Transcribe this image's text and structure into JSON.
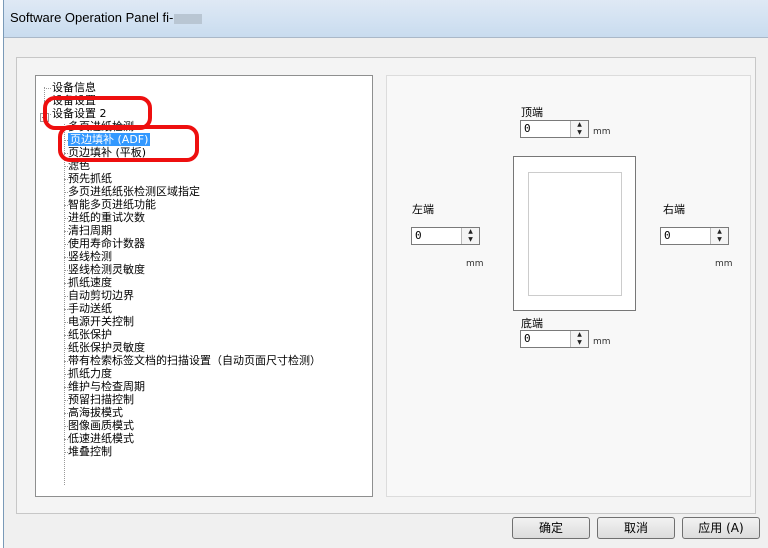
{
  "window": {
    "title": "Software Operation Panel fi-"
  },
  "tree": {
    "items": [
      {
        "label": "设备信息",
        "level": 0
      },
      {
        "label": "设备设置",
        "level": 0
      },
      {
        "label": "设备设置 2",
        "level": 0
      },
      {
        "label": "多页进纸检测",
        "level": 1
      },
      {
        "label": "页边填补 (ADF)",
        "level": 1,
        "selected": true
      },
      {
        "label": "页边填补 (平板)",
        "level": 1
      },
      {
        "label": "滤色",
        "level": 1
      },
      {
        "label": "预先抓纸",
        "level": 1
      },
      {
        "label": "多页进纸纸张检测区域指定",
        "level": 1
      },
      {
        "label": "智能多页进纸功能",
        "level": 1
      },
      {
        "label": "进纸的重试次数",
        "level": 1
      },
      {
        "label": "清扫周期",
        "level": 1
      },
      {
        "label": "使用寿命计数器",
        "level": 1
      },
      {
        "label": "竖线检测",
        "level": 1
      },
      {
        "label": "竖线检测灵敏度",
        "level": 1
      },
      {
        "label": "抓纸速度",
        "level": 1
      },
      {
        "label": "自动剪切边界",
        "level": 1
      },
      {
        "label": "手动送纸",
        "level": 1
      },
      {
        "label": "电源开关控制",
        "level": 1
      },
      {
        "label": "纸张保护",
        "level": 1
      },
      {
        "label": "纸张保护灵敏度",
        "level": 1
      },
      {
        "label": "带有检索标签文档的扫描设置（自动页面尺寸检测）",
        "level": 1
      },
      {
        "label": "抓纸力度",
        "level": 1
      },
      {
        "label": "维护与检查周期",
        "level": 1
      },
      {
        "label": "预留扫描控制",
        "level": 1
      },
      {
        "label": "高海拔模式",
        "level": 1
      },
      {
        "label": "图像画质模式",
        "level": 1
      },
      {
        "label": "低速进纸模式",
        "level": 1
      },
      {
        "label": "堆叠控制",
        "level": 1
      }
    ],
    "expander": "−"
  },
  "margins": {
    "top_label": "顶端",
    "bottom_label": "底端",
    "left_label": "左端",
    "right_label": "右端",
    "unit": "mm",
    "top_value": "0",
    "bottom_value": "0",
    "left_value": "0",
    "right_value": "0"
  },
  "buttons": {
    "ok": "确定",
    "cancel": "取消",
    "apply": "应用 (A)"
  },
  "colors": {
    "selection": "#3399ff",
    "annotation": "#ee0f0f"
  }
}
